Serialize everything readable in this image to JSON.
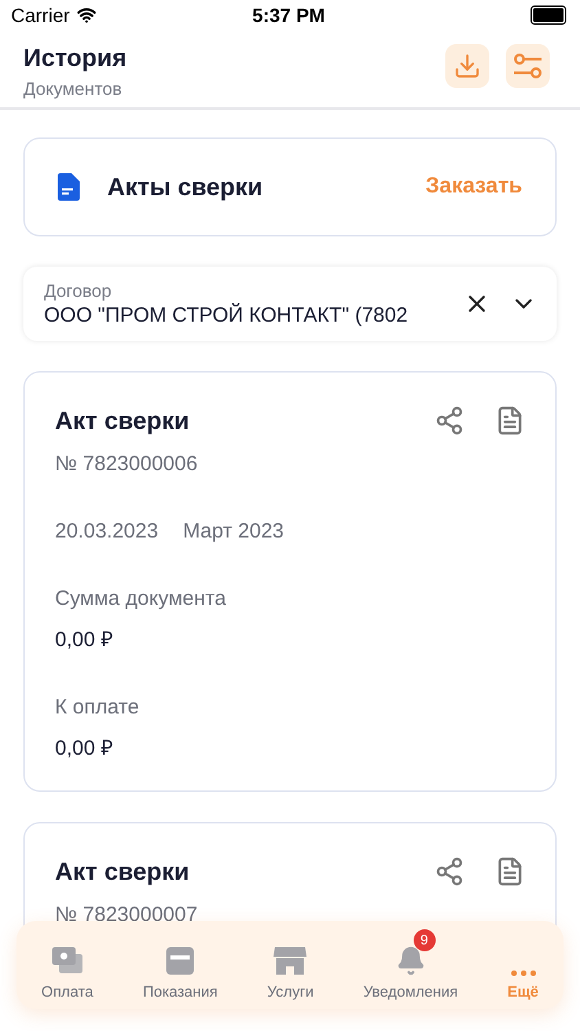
{
  "status_bar": {
    "carrier": "Carrier",
    "time": "5:37 PM"
  },
  "header": {
    "title": "История",
    "subtitle": "Документов"
  },
  "order_card": {
    "title": "Акты сверки",
    "action": "Заказать"
  },
  "contract_field": {
    "label": "Договор",
    "value": "ООО \"ПРОМ СТРОЙ КОНТАКТ\" (7802"
  },
  "documents": [
    {
      "title": "Акт сверки",
      "number": "№ 7823000006",
      "date": "20.03.2023",
      "period": "Март 2023",
      "fields": [
        {
          "label": "Сумма документа",
          "value": "0,00 ₽"
        },
        {
          "label": "К оплате",
          "value": "0,00 ₽"
        }
      ]
    },
    {
      "title": "Акт сверки",
      "number": "№ 7823000007"
    }
  ],
  "tab_bar": [
    {
      "kind": "payment",
      "label": "Оплата",
      "selected": false
    },
    {
      "kind": "meter",
      "label": "Показания",
      "selected": false
    },
    {
      "kind": "shop",
      "label": "Услуги",
      "selected": false
    },
    {
      "kind": "bell",
      "label": "Уведомления",
      "selected": false,
      "badge": "9"
    },
    {
      "kind": "more",
      "label": "Ещё",
      "selected": true
    }
  ]
}
